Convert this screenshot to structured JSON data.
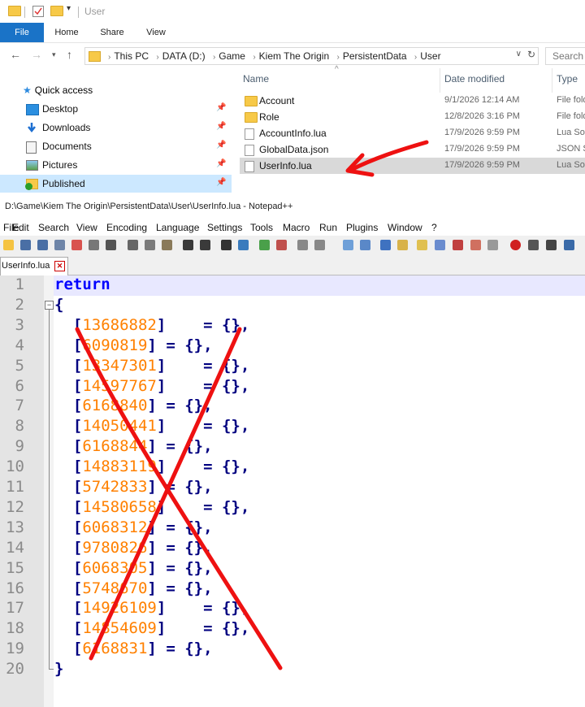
{
  "explorer": {
    "title": "User",
    "ribbon_tabs": [
      "File",
      "Home",
      "Share",
      "View"
    ],
    "breadcrumbs": [
      "This PC",
      "DATA (D:)",
      "Game",
      "Kiem The Origin",
      "PersistentData",
      "User"
    ],
    "search_placeholder": "Search U",
    "quick_access": "Quick access",
    "nav_items": [
      {
        "label": "Desktop",
        "icon": "desktop-icon",
        "pinned": true
      },
      {
        "label": "Downloads",
        "icon": "download-icon",
        "pinned": true
      },
      {
        "label": "Documents",
        "icon": "documents-icon",
        "pinned": true
      },
      {
        "label": "Pictures",
        "icon": "pictures-icon",
        "pinned": true
      },
      {
        "label": "Published",
        "icon": "published-icon",
        "pinned": true,
        "selected": true
      }
    ],
    "columns": {
      "name": "Name",
      "date": "Date modified",
      "type": "Type"
    },
    "files": [
      {
        "name": "Account",
        "date": "9/1/2026 12:14 AM",
        "type": "File fold",
        "icon": "folder-icon"
      },
      {
        "name": "Role",
        "date": "12/8/2026 3:16 PM",
        "type": "File fold",
        "icon": "folder-icon"
      },
      {
        "name": "AccountInfo.lua",
        "date": "17/9/2026 9:59 PM",
        "type": "Lua Sou",
        "icon": "file-icon"
      },
      {
        "name": "GlobalData.json",
        "date": "17/9/2026 9:59 PM",
        "type": "JSON S",
        "icon": "file-icon"
      },
      {
        "name": "UserInfo.lua",
        "date": "17/9/2026 9:59 PM",
        "type": "Lua Sou",
        "icon": "file-icon",
        "selected": true
      }
    ]
  },
  "notepad": {
    "title": "D:\\Game\\Kiem The Origin\\PersistentData\\User\\UserInfo.lua - Notepad++",
    "menu": [
      "File",
      "Edit",
      "Search",
      "View",
      "Encoding",
      "Language",
      "Settings",
      "Tools",
      "Macro",
      "Run",
      "Plugins",
      "Window",
      "?"
    ],
    "tab_label": "UserInfo.lua",
    "lines": [
      {
        "n": "1",
        "kw": "return",
        "key": "",
        "tail": ""
      },
      {
        "n": "2",
        "op": "{"
      },
      {
        "n": "3",
        "key": "13686882",
        "tail": "    = {},"
      },
      {
        "n": "4",
        "key": "6090819",
        "tail": " = {},"
      },
      {
        "n": "5",
        "key": "13347301",
        "tail": "    = {},"
      },
      {
        "n": "6",
        "key": "14597767",
        "tail": "    = {},"
      },
      {
        "n": "7",
        "key": "6168840",
        "tail": " = {},"
      },
      {
        "n": "8",
        "key": "14050441",
        "tail": "    = {},"
      },
      {
        "n": "9",
        "key": "6168844",
        "tail": " = {},"
      },
      {
        "n": "10",
        "key": "14883119",
        "tail": "    = {},"
      },
      {
        "n": "11",
        "key": "5742833",
        "tail": " = {},"
      },
      {
        "n": "12",
        "key": "14580658",
        "tail": "    = {},"
      },
      {
        "n": "13",
        "key": "6068312",
        "tail": " = {},"
      },
      {
        "n": "14",
        "key": "9780826",
        "tail": " = {},"
      },
      {
        "n": "15",
        "key": "6068305",
        "tail": " = {},"
      },
      {
        "n": "16",
        "key": "5748670",
        "tail": " = {},"
      },
      {
        "n": "17",
        "key": "14926109",
        "tail": "    = {},"
      },
      {
        "n": "18",
        "key": "14854609",
        "tail": "    = {},"
      },
      {
        "n": "19",
        "key": "6168831",
        "tail": " = {},"
      },
      {
        "n": "20",
        "op": "}"
      }
    ]
  },
  "colors": {
    "accent_blue": "#1a73c7",
    "annotation_red": "#ee1111",
    "number_orange": "#ff8000",
    "keyword_blue": "#0000ff",
    "operator_navy": "#000080"
  }
}
